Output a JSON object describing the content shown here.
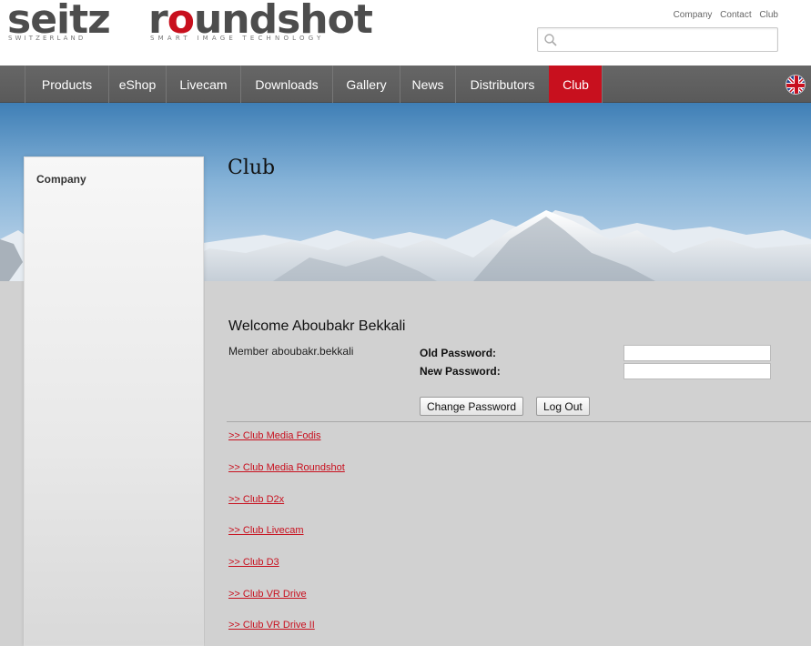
{
  "header": {
    "logo_seitz": "seitz",
    "logo_seitz_sub": "SWITZERLAND",
    "logo_roundshot": "roundshot",
    "logo_roundshot_sub": "SMART IMAGE TECHNOLOGY",
    "top_links": [
      "Company",
      "Contact",
      "Club"
    ],
    "search": {
      "placeholder": "",
      "value": ""
    }
  },
  "nav": {
    "items": [
      "Products",
      "eShop",
      "Livecam",
      "Downloads",
      "Gallery",
      "News",
      "Distributors",
      "Club"
    ],
    "active": "Club",
    "language_icon": "uk-flag-icon"
  },
  "sidebar": {
    "items": [
      "Company"
    ]
  },
  "page": {
    "title": "Club"
  },
  "account": {
    "welcome": "Welcome Aboubakr Bekkali",
    "member": "Member aboubakr.bekkali",
    "old_password_label": "Old Password:",
    "new_password_label": "New Password:",
    "change_password_button": "Change Password",
    "logout_button": "Log Out"
  },
  "club_links": [
    ">> Club Media Fodis",
    ">> Club Media Roundshot",
    ">> Club D2x",
    ">> Club Livecam",
    ">> Club D3",
    ">> Club VR Drive",
    ">> Club VR Drive II"
  ],
  "colors": {
    "brand_red": "#c8101e",
    "nav_bg": "#5f5f5f",
    "content_bg": "#d1d1d1"
  }
}
